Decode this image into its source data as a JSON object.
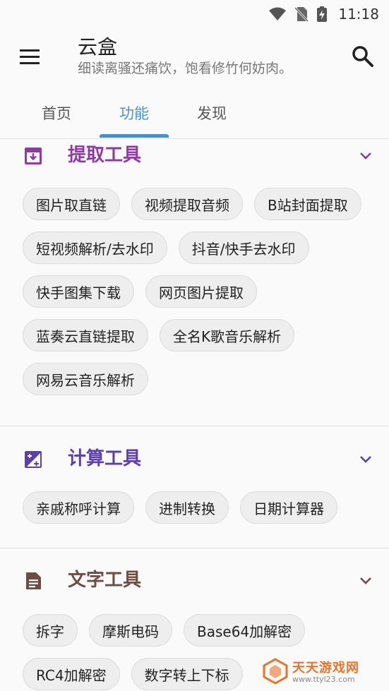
{
  "status_bar": {
    "time": "11:18"
  },
  "app_bar": {
    "title": "云盒",
    "subtitle": "细读离骚还痛饮，饱看修竹何妨肉。"
  },
  "tabs": [
    {
      "label": "首页"
    },
    {
      "label": "功能"
    },
    {
      "label": "发现"
    }
  ],
  "sections": [
    {
      "title": "提取工具",
      "color": "#8e3aa6",
      "chips": [
        "图片取直链",
        "视频提取音频",
        "B站封面提取",
        "短视频解析/去水印",
        "抖音/快手去水印",
        "快手图集下载",
        "网页图片提取",
        "蓝奏云直链提取",
        "全名K歌音乐解析",
        "网易云音乐解析"
      ]
    },
    {
      "title": "计算工具",
      "color": "#5b3fae",
      "chips": [
        "亲戚称呼计算",
        "进制转换",
        "日期计算器"
      ]
    },
    {
      "title": "文字工具",
      "color": "#6d4c41",
      "chips": [
        "拆字",
        "摩斯电码",
        "Base64加解密",
        "RC4加解密",
        "数字转上下标"
      ]
    }
  ],
  "watermark": {
    "text": "天天游戏网",
    "url": "www.ttyl23.com"
  }
}
